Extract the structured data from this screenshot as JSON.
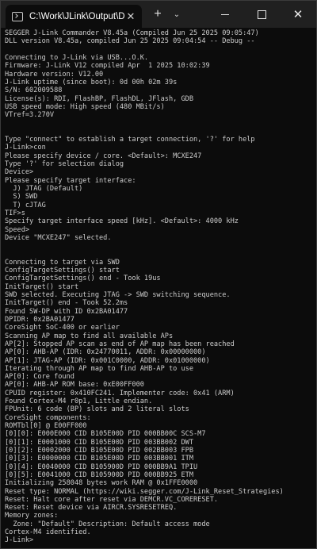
{
  "window": {
    "tab_title": "C:\\Work\\JLink\\Output\\Debug",
    "tab_close_glyph": "✕",
    "new_tab_glyph": "+",
    "dropdown_glyph": "⌄",
    "close_glyph": "✕"
  },
  "terminal": {
    "lines": [
      "SEGGER J-Link Commander V8.45a (Compiled Jun 25 2025 09:05:47)",
      "DLL version V8.45a, compiled Jun 25 2025 09:04:54 -- Debug --",
      "",
      "Connecting to J-Link via USB...O.K.",
      "Firmware: J-Link V12 compiled Apr  1 2025 10:02:39",
      "Hardware version: V12.00",
      "J-Link uptime (since boot): 0d 00h 02m 39s",
      "S/N: 602009588",
      "License(s): RDI, FlashBP, FlashDL, JFlash, GDB",
      "USB speed mode: High speed (480 MBit/s)",
      "VTref=3.270V",
      "",
      "",
      "Type \"connect\" to establish a target connection, '?' for help",
      "J-Link>con",
      "Please specify device / core. <Default>: MCXE247",
      "Type '?' for selection dialog",
      "Device>",
      "Please specify target interface:",
      "  J) JTAG (Default)",
      "  S) SWD",
      "  T) cJTAG",
      "TIF>s",
      "Specify target interface speed [kHz]. <Default>: 4000 kHz",
      "Speed>",
      "Device \"MCXE247\" selected.",
      "",
      "",
      "Connecting to target via SWD",
      "ConfigTargetSettings() start",
      "ConfigTargetSettings() end - Took 19us",
      "InitTarget() start",
      "SWD selected. Executing JTAG -> SWD switching sequence.",
      "InitTarget() end - Took 52.2ms",
      "Found SW-DP with ID 0x2BA01477",
      "DPIDR: 0x2BA01477",
      "CoreSight SoC-400 or earlier",
      "Scanning AP map to find all available APs",
      "AP[2]: Stopped AP scan as end of AP map has been reached",
      "AP[0]: AHB-AP (IDR: 0x24770011, ADDR: 0x00000000)",
      "AP[1]: JTAG-AP (IDR: 0x001C0000, ADDR: 0x01000000)",
      "Iterating through AP map to find AHB-AP to use",
      "AP[0]: Core found",
      "AP[0]: AHB-AP ROM base: 0xE00FF000",
      "CPUID register: 0x410FC241. Implementer code: 0x41 (ARM)",
      "Found Cortex-M4 r0p1, Little endian.",
      "FPUnit: 6 code (BP) slots and 2 literal slots",
      "CoreSight components:",
      "ROMTbl[0] @ E00FF000",
      "[0][0]: E000E000 CID B105E00D PID 000BB00C SCS-M7",
      "[0][1]: E0001000 CID B105E00D PID 003BB002 DWT",
      "[0][2]: E0002000 CID B105E00D PID 002BB003 FPB",
      "[0][3]: E0000000 CID B105E00D PID 003BB001 ITM",
      "[0][4]: E0040000 CID B105900D PID 000BB9A1 TPIU",
      "[0][5]: E0041000 CID B105900D PID 000BB925 ETM",
      "Initializing 258048 bytes work RAM @ 0x1FFE0000",
      "Reset type: NORMAL (https://wiki.segger.com/J-Link_Reset_Strategies)",
      "Reset: Halt core after reset via DEMCR.VC_CORERESET.",
      "Reset: Reset device via AIRCR.SYSRESETREQ.",
      "Memory zones:",
      "  Zone: \"Default\" Description: Default access mode",
      "Cortex-M4 identified.",
      "J-Link>"
    ]
  }
}
